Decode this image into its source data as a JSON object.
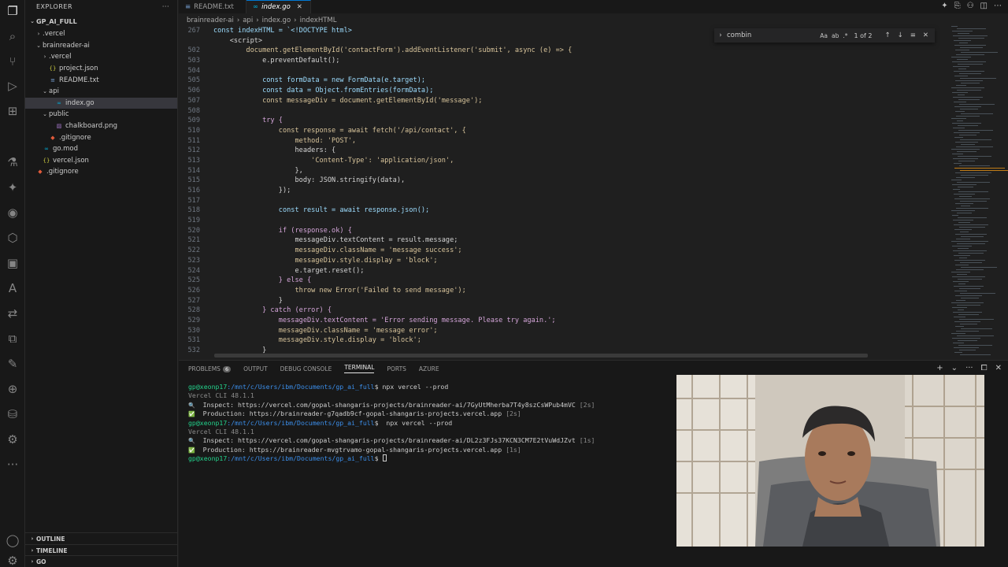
{
  "activity": {
    "items": [
      {
        "name": "explorer-icon",
        "glyph": "❐"
      },
      {
        "name": "search-icon",
        "glyph": "⌕"
      },
      {
        "name": "source-control-icon",
        "glyph": "⑂"
      },
      {
        "name": "run-debug-icon",
        "glyph": "▷"
      },
      {
        "name": "extensions-icon",
        "glyph": "⊞",
        "badge": "1"
      },
      {
        "name": "testing-icon",
        "glyph": "⚗"
      },
      {
        "name": "copilot-icon",
        "glyph": "✦"
      },
      {
        "name": "github-icon",
        "glyph": "◉"
      },
      {
        "name": "box-icon",
        "glyph": "⬡"
      },
      {
        "name": "remote-explorer-icon",
        "glyph": "▣"
      },
      {
        "name": "azure-icon",
        "glyph": "A"
      },
      {
        "name": "share-icon",
        "glyph": "⇄"
      },
      {
        "name": "extension-panel-icon",
        "glyph": "⧉"
      },
      {
        "name": "pen-icon",
        "glyph": "✎"
      },
      {
        "name": "globe-icon",
        "glyph": "⊕"
      },
      {
        "name": "database-icon",
        "glyph": "⛁"
      },
      {
        "name": "puzzle-icon",
        "glyph": "⚙"
      },
      {
        "name": "more-icon",
        "glyph": "···"
      }
    ],
    "account_glyph": "◯",
    "manage_glyph": "⚙"
  },
  "sidebar": {
    "title": "EXPLORER",
    "more": "···",
    "root": "GP_AI_FULL",
    "items": [
      {
        "label": ".vercel",
        "type": "folder",
        "open": false,
        "depth": 1
      },
      {
        "label": "brainreader-ai",
        "type": "folder",
        "open": true,
        "depth": 1
      },
      {
        "label": ".vercel",
        "type": "folder",
        "open": false,
        "depth": 2
      },
      {
        "label": "project.json",
        "type": "json",
        "depth": 2
      },
      {
        "label": "README.txt",
        "type": "txt",
        "depth": 2
      },
      {
        "label": "api",
        "type": "folder",
        "open": true,
        "depth": 2
      },
      {
        "label": "index.go",
        "type": "go",
        "depth": 3,
        "selected": true
      },
      {
        "label": "public",
        "type": "folder",
        "open": true,
        "depth": 2
      },
      {
        "label": "chalkboard.png",
        "type": "png",
        "depth": 3
      },
      {
        "label": ".gitignore",
        "type": "git",
        "depth": 2
      },
      {
        "label": "go.mod",
        "type": "go",
        "depth": 1
      },
      {
        "label": "vercel.json",
        "type": "json",
        "depth": 1
      },
      {
        "label": ".gitignore",
        "type": "git",
        "depth": 0
      }
    ],
    "outline": "OUTLINE",
    "timeline": "TIMELINE",
    "go": "GO"
  },
  "tabs": [
    {
      "label": "README.txt",
      "icon": "≡",
      "active": false
    },
    {
      "label": "index.go",
      "icon": "∞",
      "active": true,
      "close": "✕"
    }
  ],
  "editor_actions": [
    "✦",
    "⎘",
    "⚇",
    "◫",
    "⋯"
  ],
  "breadcrumb": [
    "brainreader-ai",
    "api",
    "index.go",
    "indexHTML"
  ],
  "sticky": {
    "num": "267",
    "text": "const indexHTML = `<!DOCTYPE html>"
  },
  "code": [
    {
      "n": "",
      "t": "    <script>"
    },
    {
      "n": "502",
      "t": "        document.getElementById('contactForm').addEventListener('submit', async (e) => {"
    },
    {
      "n": "503",
      "t": "            e.preventDefault();"
    },
    {
      "n": "504",
      "t": ""
    },
    {
      "n": "505",
      "t": "            const formData = new FormData(e.target);"
    },
    {
      "n": "506",
      "t": "            const data = Object.fromEntries(formData);"
    },
    {
      "n": "507",
      "t": "            const messageDiv = document.getElementById('message');"
    },
    {
      "n": "508",
      "t": ""
    },
    {
      "n": "509",
      "t": "            try {"
    },
    {
      "n": "510",
      "t": "                const response = await fetch('/api/contact', {"
    },
    {
      "n": "511",
      "t": "                    method: 'POST',"
    },
    {
      "n": "512",
      "t": "                    headers: {"
    },
    {
      "n": "513",
      "t": "                        'Content-Type': 'application/json',"
    },
    {
      "n": "514",
      "t": "                    },"
    },
    {
      "n": "515",
      "t": "                    body: JSON.stringify(data),"
    },
    {
      "n": "516",
      "t": "                });"
    },
    {
      "n": "517",
      "t": ""
    },
    {
      "n": "518",
      "t": "                const result = await response.json();"
    },
    {
      "n": "519",
      "t": ""
    },
    {
      "n": "520",
      "t": "                if (response.ok) {"
    },
    {
      "n": "521",
      "t": "                    messageDiv.textContent = result.message;"
    },
    {
      "n": "522",
      "t": "                    messageDiv.className = 'message success';"
    },
    {
      "n": "523",
      "t": "                    messageDiv.style.display = 'block';"
    },
    {
      "n": "524",
      "t": "                    e.target.reset();"
    },
    {
      "n": "525",
      "t": "                } else {"
    },
    {
      "n": "526",
      "t": "                    throw new Error('Failed to send message');"
    },
    {
      "n": "527",
      "t": "                }"
    },
    {
      "n": "528",
      "t": "            } catch (error) {"
    },
    {
      "n": "529",
      "t": "                messageDiv.textContent = 'Error sending message. Please try again.';"
    },
    {
      "n": "530",
      "t": "                messageDiv.className = 'message error';"
    },
    {
      "n": "531",
      "t": "                messageDiv.style.display = 'block';"
    },
    {
      "n": "532",
      "t": "            }"
    }
  ],
  "find": {
    "chevron": "›",
    "query": "combin",
    "opts": [
      "Aa",
      "ab",
      ".*"
    ],
    "count": "1 of 2",
    "prev": "↑",
    "next": "↓",
    "selection": "≡",
    "close": "✕"
  },
  "panel": {
    "tabs": [
      {
        "label": "PROBLEMS",
        "badge": "6"
      },
      {
        "label": "OUTPUT"
      },
      {
        "label": "DEBUG CONSOLE"
      },
      {
        "label": "TERMINAL",
        "active": true
      },
      {
        "label": "PORTS"
      },
      {
        "label": "AZURE"
      }
    ],
    "actions": [
      "+",
      "⌄",
      "···",
      "⧠",
      "✕"
    ]
  },
  "terminal": {
    "prompt_user": "gp@xeonp17",
    "prompt_path": ":/mnt/c/Users/ibm/Documents/gp_ai_full",
    "lines": [
      {
        "kind": "prompt",
        "cmd": " npx vercel --prod"
      },
      {
        "kind": "dim",
        "text": "Vercel CLI 48.1.1"
      },
      {
        "kind": "info",
        "icon": "🔍",
        "label": "  Inspect: ",
        "text": "https://vercel.com/gopal-shangaris-projects/brainreader-ai/7GyUtMherba7T4y8szCsWPub4mVC",
        "time": " [2s]"
      },
      {
        "kind": "ok",
        "icon": "✅",
        "label": "  Production: ",
        "text": "https://brainreader-g7qadb9cf-gopal-shangaris-projects.vercel.app",
        "time": " [2s]"
      },
      {
        "kind": "prompt",
        "cmd": "  npx vercel --prod"
      },
      {
        "kind": "dim",
        "text": "Vercel CLI 48.1.1"
      },
      {
        "kind": "info",
        "icon": "🔍",
        "label": "  Inspect: ",
        "text": "https://vercel.com/gopal-shangaris-projects/brainreader-ai/DL2z3FJs37KCN3CM7E2tVuWdJZvt",
        "time": " [1s]"
      },
      {
        "kind": "ok",
        "icon": "✅",
        "label": "  Production: ",
        "text": "https://brainreader-mvgtrvamo-gopal-shangaris-projects.vercel.app",
        "time": " [1s]"
      },
      {
        "kind": "prompt",
        "cmd": " "
      }
    ]
  }
}
